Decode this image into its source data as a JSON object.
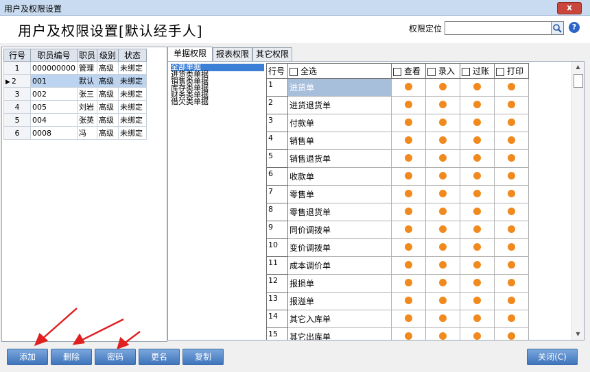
{
  "window": {
    "title": "用户及权限设置",
    "close_label": "x"
  },
  "header": {
    "title": "用户及权限设置[默认经手人]",
    "locate_label": "权限定位",
    "locate_value": "",
    "help_label": "?"
  },
  "users_table": {
    "columns": [
      "行号",
      "职员编号",
      "职员",
      "级别",
      "状态"
    ],
    "rows": [
      {
        "no": "1",
        "code": "000000000",
        "name": "管理",
        "level": "高级",
        "status": "未绑定"
      },
      {
        "no": "2",
        "code": "001",
        "name": "默认",
        "level": "高级",
        "status": "未绑定"
      },
      {
        "no": "3",
        "code": "002",
        "name": "张三",
        "level": "高级",
        "status": "未绑定"
      },
      {
        "no": "4",
        "code": "005",
        "name": "刘岩",
        "level": "高级",
        "status": "未绑定"
      },
      {
        "no": "5",
        "code": "004",
        "name": "张英",
        "level": "高级",
        "status": "未绑定"
      },
      {
        "no": "6",
        "code": "0008",
        "name": "冯",
        "level": "高级",
        "status": "未绑定"
      }
    ]
  },
  "tabs": [
    "单据权限",
    "报表权限",
    "其它权限"
  ],
  "tree": [
    "全部单据",
    "进货类单据",
    "销售类单据",
    "库存类单据",
    "财务类单据",
    "借欠类单据"
  ],
  "perm_grid": {
    "headers": {
      "no": "行号",
      "all": "全选",
      "view": "查看",
      "entry": "录入",
      "post": "过账",
      "print": "打印"
    },
    "rows": [
      {
        "no": "1",
        "name": "进货单"
      },
      {
        "no": "2",
        "name": "进货退货单"
      },
      {
        "no": "3",
        "name": "付款单"
      },
      {
        "no": "4",
        "name": "销售单"
      },
      {
        "no": "5",
        "name": "销售退货单"
      },
      {
        "no": "6",
        "name": "收款单"
      },
      {
        "no": "7",
        "name": "零售单"
      },
      {
        "no": "8",
        "name": "零售退货单"
      },
      {
        "no": "9",
        "name": "同价调拨单"
      },
      {
        "no": "10",
        "name": "变价调拨单"
      },
      {
        "no": "11",
        "name": "成本调价单"
      },
      {
        "no": "12",
        "name": "报损单"
      },
      {
        "no": "13",
        "name": "报溢单"
      },
      {
        "no": "14",
        "name": "其它入库单"
      },
      {
        "no": "15",
        "name": "其它出库单"
      }
    ]
  },
  "buttons": {
    "add": "添加",
    "delete": "删除",
    "password": "密码",
    "rename": "更名",
    "copy": "复制",
    "close": "关闭(C)"
  },
  "colors": {
    "accent": "#3e74bb",
    "dot": "#f08a1e",
    "selection": "#bcd4f0",
    "arrow": "#e02020"
  }
}
